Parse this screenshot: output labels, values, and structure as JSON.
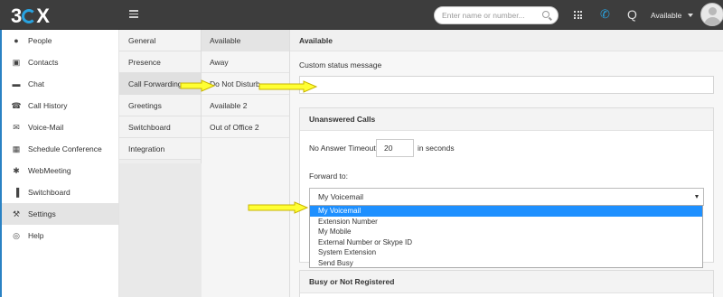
{
  "topbar": {
    "logo": {
      "three": "3",
      "x": "X"
    },
    "search_placeholder": "Enter name or number...",
    "status_label": "Available",
    "icons": [
      "menu-icon",
      "search-icon",
      "dialpad-icon",
      "phone-icon",
      "queue-icon",
      "avatar"
    ]
  },
  "sidebar": {
    "items": [
      {
        "label": "People",
        "icon": "person-icon",
        "glyph": "●"
      },
      {
        "label": "Contacts",
        "icon": "contacts-icon",
        "glyph": "▣"
      },
      {
        "label": "Chat",
        "icon": "chat-icon",
        "glyph": "▬"
      },
      {
        "label": "Call History",
        "icon": "call-history-icon",
        "glyph": "☎"
      },
      {
        "label": "Voice-Mail",
        "icon": "envelope-icon",
        "glyph": "✉"
      },
      {
        "label": "Schedule Conference",
        "icon": "calendar-icon",
        "glyph": "▦"
      },
      {
        "label": "WebMeeting",
        "icon": "group-icon",
        "glyph": "✱"
      },
      {
        "label": "Switchboard",
        "icon": "bar-chart-icon",
        "glyph": "▐"
      },
      {
        "label": "Settings",
        "icon": "wrench-icon",
        "glyph": "⚒"
      },
      {
        "label": "Help",
        "icon": "lifebuoy-icon",
        "glyph": "◎"
      }
    ]
  },
  "settings_menu": {
    "items": [
      "General",
      "Presence",
      "Call Forwarding",
      "Greetings",
      "Switchboard",
      "Integration"
    ]
  },
  "status_menu": {
    "items": [
      "Available",
      "Away",
      "Do Not Disturb",
      "Available 2",
      "Out of Office 2"
    ]
  },
  "main": {
    "title": "Available",
    "custom_status_label": "Custom status message",
    "custom_status_value": "",
    "unanswered": {
      "title": "Unanswered Calls",
      "timeout_label": "No Answer Timeout",
      "timeout_value": "20",
      "timeout_unit": "in seconds",
      "forward_label": "Forward to:",
      "selected": "My Voicemail",
      "options": [
        "My Voicemail",
        "Extension Number",
        "My Mobile",
        "External Number or Skype ID",
        "System Extension",
        "Send Busy"
      ]
    },
    "busy_title": "Busy or Not Registered"
  },
  "colors": {
    "topbar": "#3d3d3d",
    "accent": "#29a3e0",
    "selection": "#1e90ff",
    "annotation_arrow": "#ffff33"
  }
}
